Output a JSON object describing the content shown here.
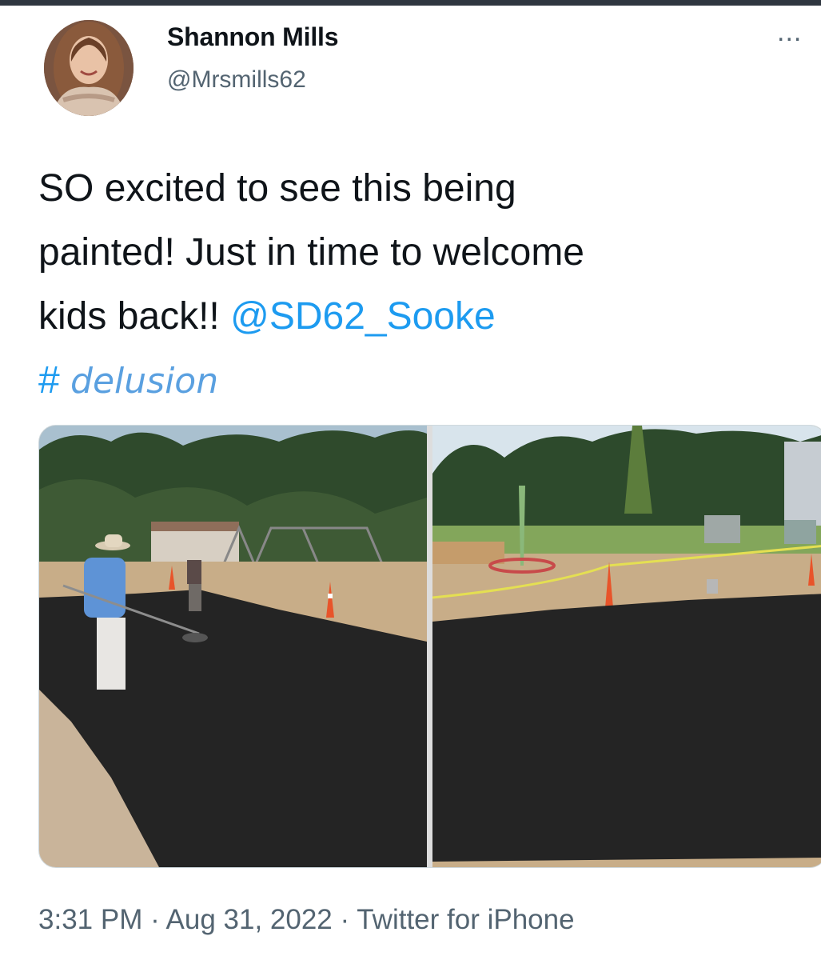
{
  "tweet": {
    "author_name": "Shannon Mills",
    "author_handle": "@Mrsmills62",
    "text_line1": "SO excited to see this being",
    "text_line2": "painted! Just in time to welcome",
    "text_line3_prefix": "kids back!! ",
    "mention": "@SD62_Sooke",
    "hashtag_symbol": "# ",
    "hashtag_word": "delusion",
    "more_label": "...",
    "timestamp": "3:31 PM · Aug 31, 2022 · Twitter for iPhone"
  },
  "colors": {
    "link": "#1d9bf0",
    "secondary_text": "#536471",
    "paint_overlay": "#242424"
  },
  "icons": {
    "more": "more-horizontal-icon"
  }
}
